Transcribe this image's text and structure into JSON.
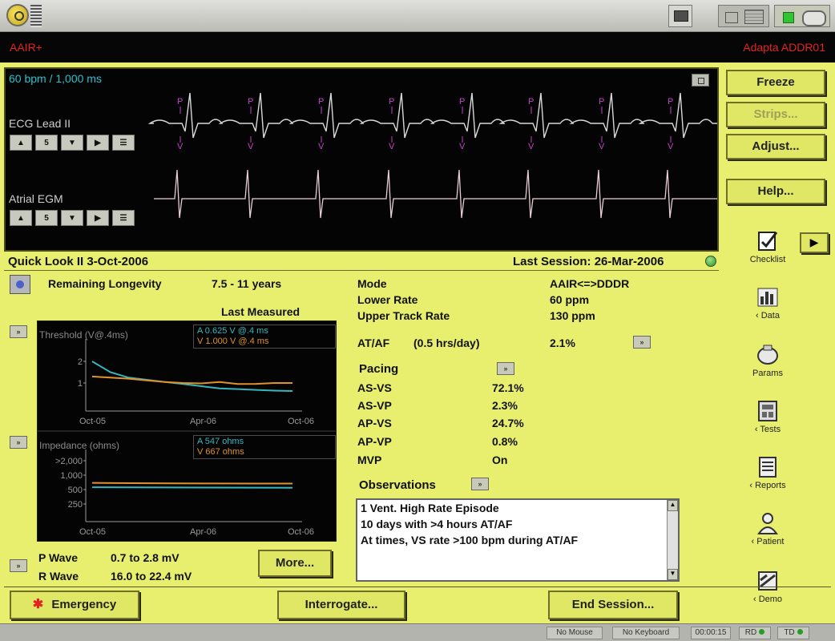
{
  "header": {
    "mode_left": "AAIR+",
    "device": "Adapta ADDR01"
  },
  "ecg": {
    "rate": "60 bpm / 1,000 ms",
    "lead1": "ECG Lead II",
    "lead2": "Atrial EGM",
    "markers": [
      "P",
      "V"
    ]
  },
  "right_buttons": {
    "freeze": "Freeze",
    "strips": "Strips...",
    "adjust": "Adjust...",
    "help": "Help..."
  },
  "right_icons": {
    "checklist": "Checklist",
    "data": "‹ Data",
    "params": "Params",
    "tests": "‹ Tests",
    "reports": "‹ Reports",
    "patient": "‹ Patient",
    "demo": "‹ Demo"
  },
  "quicklook": {
    "title": "Quick Look II  3-Oct-2006",
    "last_session": "Last Session: 26-Mar-2006",
    "longevity_label": "Remaining Longevity",
    "longevity_value": "7.5 - 11 years",
    "last_measured": "Last Measured",
    "threshold_title": "Threshold (V@.4ms)",
    "threshold_legend_a": "A   0.625 V @.4 ms",
    "threshold_legend_v": "V   1.000 V @.4 ms",
    "threshold_ticks": [
      "2",
      "1"
    ],
    "impedance_title": "Impedance (ohms)",
    "impedance_legend_a": "A   547 ohms",
    "impedance_legend_v": "V   667 ohms",
    "impedance_ticks": [
      ">2,000",
      "1,000",
      "500",
      "250"
    ],
    "x_ticks": [
      "Oct-05",
      "Apr-06",
      "Oct-06"
    ],
    "p_wave_label": "P Wave",
    "p_wave_value": "0.7 to 2.8 mV",
    "r_wave_label": "R Wave",
    "r_wave_value": "16.0 to 22.4 mV",
    "more": "More..."
  },
  "params": {
    "mode_label": "Mode",
    "mode_value": "AAIR<=>DDDR",
    "lower_rate_label": "Lower Rate",
    "lower_rate_value": "60 ppm",
    "upper_track_label": "Upper Track Rate",
    "upper_track_value": "130 ppm",
    "ataf_label": "AT/AF",
    "ataf_sub": "(0.5 hrs/day)",
    "ataf_value": "2.1%",
    "pacing_label": "Pacing",
    "pacing": [
      {
        "label": "AS-VS",
        "value": "72.1%"
      },
      {
        "label": "AS-VP",
        "value": "2.3%"
      },
      {
        "label": "AP-VS",
        "value": "24.7%"
      },
      {
        "label": "AP-VP",
        "value": "0.8%"
      }
    ],
    "mvp_label": "MVP",
    "mvp_value": "On"
  },
  "observations": {
    "title": "Observations",
    "items": [
      "1 Vent. High Rate Episode",
      "10 days with >4 hours AT/AF",
      "At times, VS rate >100 bpm during AT/AF"
    ]
  },
  "bottom": {
    "emergency": "Emergency",
    "interrogate": "Interrogate...",
    "end_session": "End Session..."
  },
  "status": {
    "mouse": "No Mouse",
    "keyboard": "No Keyboard",
    "timer": "00:00:15",
    "rd": "RD",
    "td": "TD"
  },
  "colors": {
    "panel": "#e8ee6e",
    "accent_red": "#e42222",
    "trace_a": "#35b7c0",
    "trace_v": "#e1922a",
    "marker": "#c041c9"
  },
  "chart_data": [
    {
      "type": "line",
      "title": "Threshold (V@.4ms)",
      "x": [
        "Oct-05",
        "Apr-06",
        "Oct-06"
      ],
      "ylim": [
        0,
        2.5
      ],
      "series": [
        {
          "name": "A",
          "values": [
            2.0,
            1.5,
            1.25,
            1.15,
            1.05,
            0.95,
            0.85,
            0.75,
            0.72,
            0.68,
            0.65,
            0.63
          ]
        },
        {
          "name": "V",
          "values": [
            1.3,
            1.25,
            1.2,
            1.12,
            1.05,
            1.0,
            0.98,
            1.05,
            0.95,
            0.96,
            1.0,
            1.0
          ]
        }
      ]
    },
    {
      "type": "line",
      "title": "Impedance (ohms)",
      "x": [
        "Oct-05",
        "Apr-06",
        "Oct-06"
      ],
      "series": [
        {
          "name": "A",
          "values": [
            560,
            555,
            552,
            550,
            548,
            547
          ]
        },
        {
          "name": "V",
          "values": [
            690,
            680,
            675,
            670,
            668,
            667
          ]
        }
      ]
    }
  ]
}
